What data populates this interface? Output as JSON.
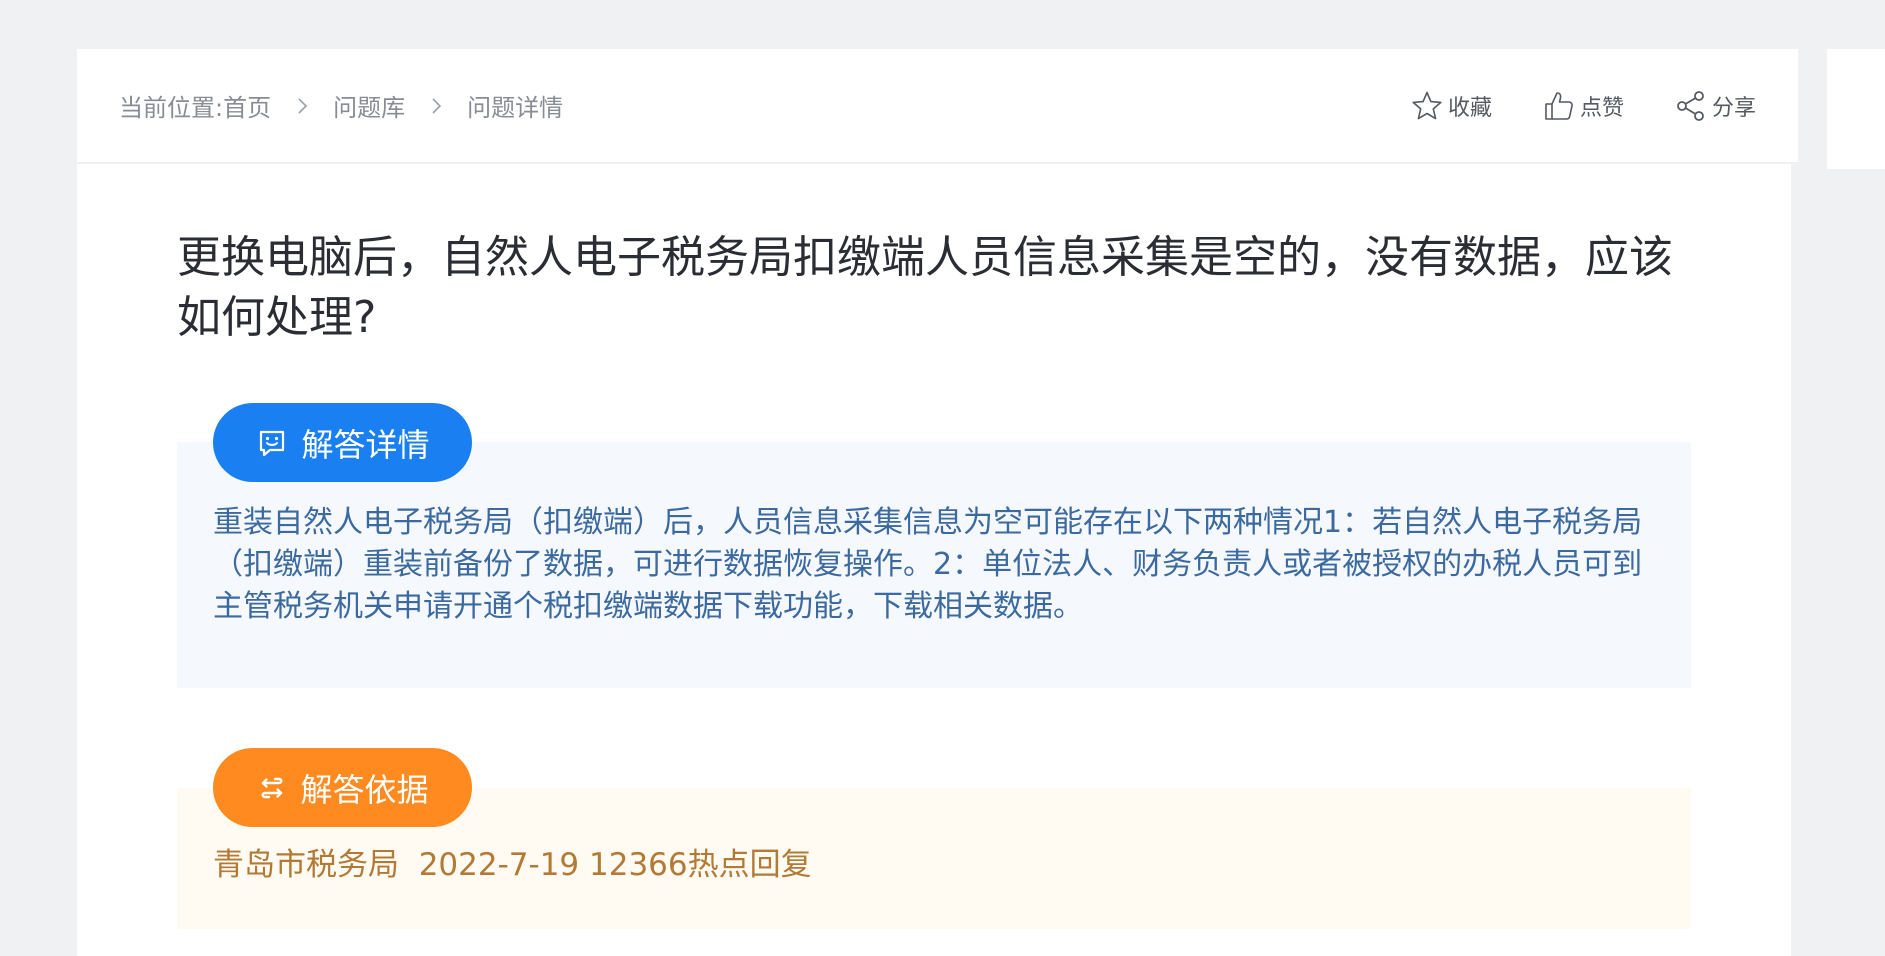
{
  "breadcrumb": {
    "prefix": "当前位置:",
    "items": [
      "首页",
      "问题库",
      "问题详情"
    ]
  },
  "actions": {
    "favorite": "收藏",
    "like": "点赞",
    "share": "分享"
  },
  "question": {
    "title": "更换电脑后，自然人电子税务局扣缴端人员信息采集是空的，没有数据，应该如何处理?"
  },
  "answer": {
    "label": "解答详情",
    "text": "重装自然人电子税务局（扣缴端）后，人员信息采集信息为空可能存在以下两种情况1：若自然人电子税务局（扣缴端）重装前备份了数据，可进行数据恢复操作。2：单位法人、财务负责人或者被授权的办税人员可到主管税务机关申请开通个税扣缴端数据下载功能，下载相关数据。"
  },
  "basis": {
    "label": "解答依据",
    "text": "青岛市税务局  2022-7-19 12366热点回复"
  },
  "colors": {
    "page_background": "#f0f1f3",
    "answer_pill": "#1a7ff0",
    "basis_pill": "#ff8a1f",
    "answer_text": "#3c6aa0",
    "basis_text": "#b27a35"
  },
  "icons": {
    "breadcrumb_separator": "chevron-right-icon",
    "favorite": "star-outline-icon",
    "like": "thumbs-up-icon",
    "share": "share-icon",
    "answer": "chat-smile-icon",
    "basis": "swap-icon"
  }
}
